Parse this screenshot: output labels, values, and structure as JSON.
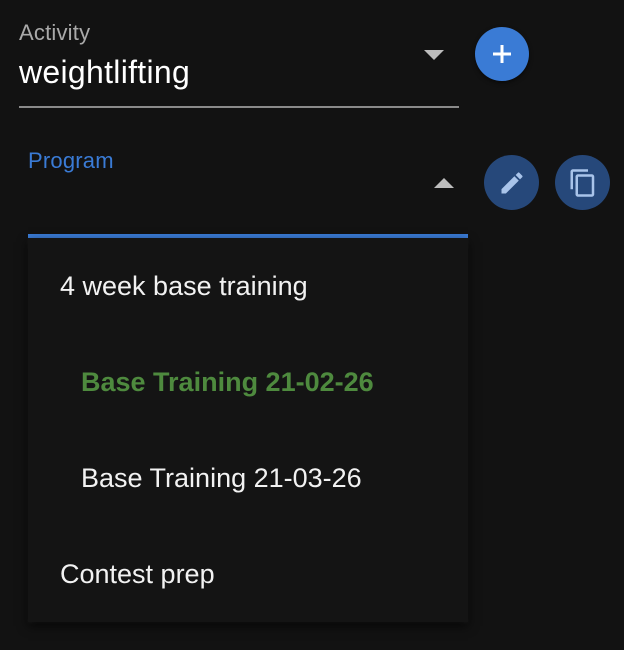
{
  "activity": {
    "label": "Activity",
    "value": "weightlifting"
  },
  "program": {
    "label": "Program"
  },
  "menu": {
    "items": [
      {
        "label": "4 week base training"
      },
      {
        "label": "Base Training 21-02-26"
      },
      {
        "label": "Base Training 21-03-26"
      },
      {
        "label": "Contest prep"
      }
    ]
  },
  "icons": {
    "add": "plus-icon",
    "edit": "pencil-icon",
    "copy": "copy-icon",
    "activity_caret": "caret-down-icon",
    "program_caret": "caret-up-icon"
  },
  "colors": {
    "accent": "#3a7bd5",
    "secondary_button": "#26487a",
    "selected_item": "#4e8a3e",
    "background": "#121212"
  }
}
